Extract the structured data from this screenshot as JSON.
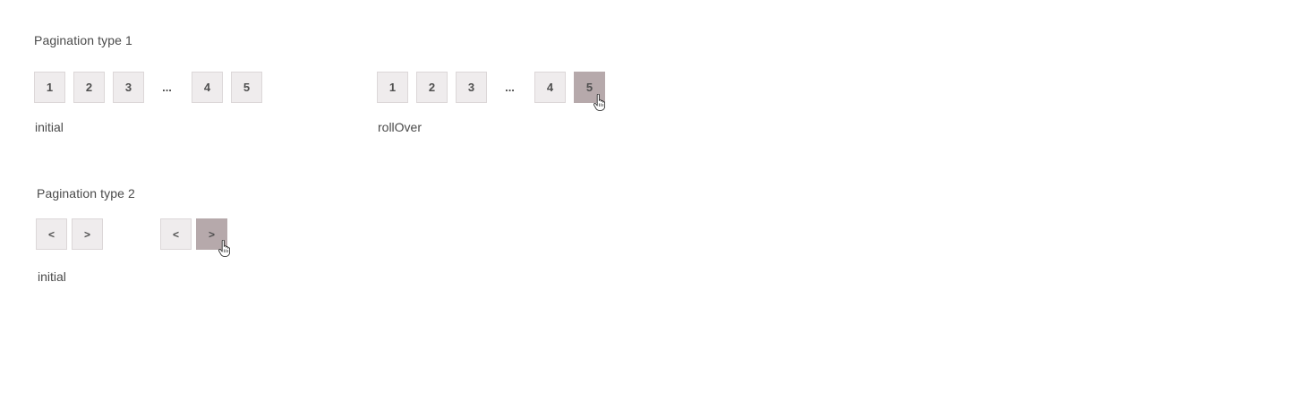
{
  "pagination_type_1": {
    "title": "Pagination type 1",
    "initial": {
      "pages": [
        "1",
        "2",
        "3",
        "4",
        "5"
      ],
      "ellipsis": "...",
      "label": "initial"
    },
    "rollover": {
      "pages": [
        "1",
        "2",
        "3",
        "4",
        "5"
      ],
      "ellipsis": "...",
      "label": "rollOver",
      "hovered_page": "5"
    }
  },
  "pagination_type_2": {
    "title": "Pagination type 2",
    "initial": {
      "prev": "<",
      "next": ">",
      "label": "initial"
    },
    "rollover": {
      "prev": "<",
      "next": ">",
      "hovered": "next"
    }
  },
  "icons": {
    "cursor": "hand-pointer-icon"
  },
  "colors": {
    "button_bg": "#efeced",
    "button_border": "#dcd7d8",
    "button_hover_bg": "#b6a9ab",
    "text": "#4a4a4a"
  }
}
